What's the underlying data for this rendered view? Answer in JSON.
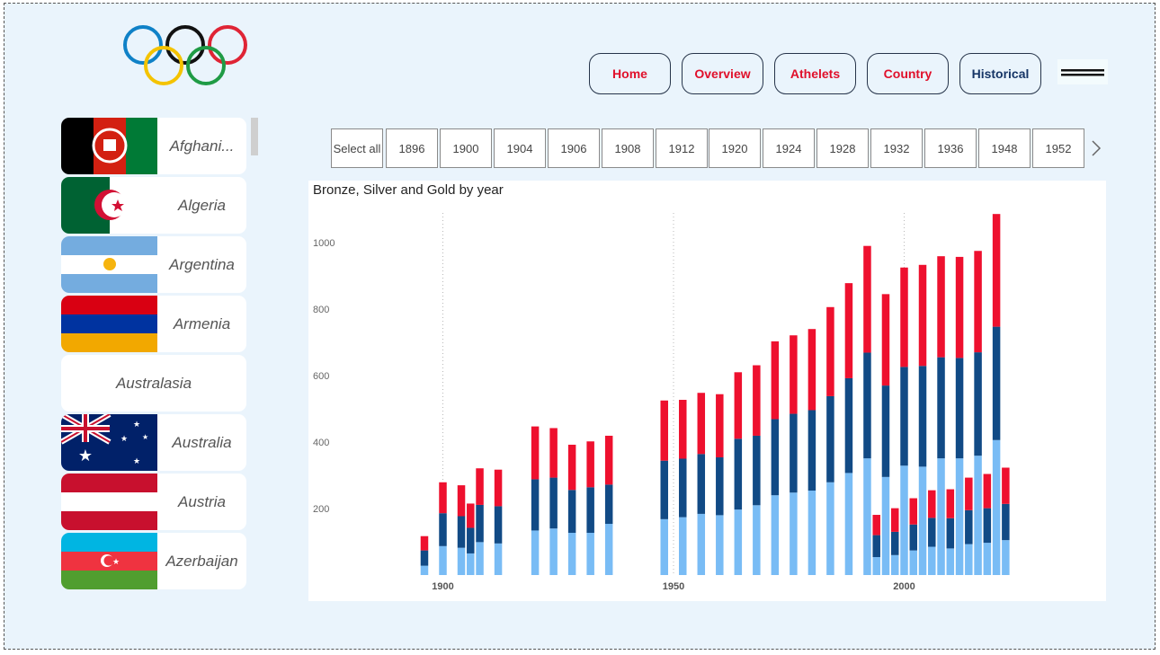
{
  "nav": {
    "home": "Home",
    "overview": "Overview",
    "athletes": "Athelets",
    "country": "Country",
    "historical": "Historical"
  },
  "countries": [
    {
      "name": "Afghani...",
      "flag": "afghanistan-flag"
    },
    {
      "name": "Algeria",
      "flag": "algeria-flag"
    },
    {
      "name": "Argentina",
      "flag": "argentina-flag"
    },
    {
      "name": "Armenia",
      "flag": "armenia-flag"
    },
    {
      "name": "Australasia",
      "flag": ""
    },
    {
      "name": "Australia",
      "flag": "australia-flag"
    },
    {
      "name": "Austria",
      "flag": "austria-flag"
    },
    {
      "name": "Azerbaijan",
      "flag": "azerbaijan-flag"
    }
  ],
  "year_slicer": {
    "select_all": "Select all",
    "years": [
      "1896",
      "1900",
      "1904",
      "1906",
      "1908",
      "1912",
      "1920",
      "1924",
      "1928",
      "1932",
      "1936",
      "1948",
      "1952"
    ]
  },
  "colors": {
    "bronze": "#79bcf5",
    "silver": "#114a85",
    "gold": "#ee102e",
    "nav_text": "#e0102b",
    "nav_active_text": "#163566",
    "background": "#eaf4fc"
  },
  "chart_data": {
    "type": "bar",
    "stacked": true,
    "title": "Bronze, Silver and Gold by year",
    "xlabel": "",
    "ylabel": "",
    "x_ticks": [
      1900,
      1950,
      2000
    ],
    "y_ticks": [
      200,
      400,
      600,
      800,
      1000
    ],
    "ylim": [
      0,
      1080
    ],
    "xlim": [
      1871,
      2028
    ],
    "grid": "vertical dotted at x ticks",
    "x": [
      1896,
      1900,
      1904,
      1906,
      1908,
      1912,
      1920,
      1924,
      1928,
      1932,
      1936,
      1948,
      1952,
      1956,
      1960,
      1964,
      1968,
      1972,
      1976,
      1980,
      1984,
      1988,
      1992,
      1994,
      1996,
      1998,
      2000,
      2002,
      2004,
      2006,
      2008,
      2010,
      2012,
      2014,
      2016,
      2018,
      2020,
      2022
    ],
    "series": [
      {
        "name": "Bronze",
        "color": "#79bcf5",
        "values": [
          28,
          87,
          82,
          65,
          99,
          95,
          134,
          140,
          127,
          127,
          154,
          168,
          174,
          184,
          180,
          197,
          210,
          240,
          248,
          254,
          279,
          307,
          351,
          54,
          295,
          60,
          329,
          74,
          326,
          85,
          351,
          80,
          351,
          93,
          359,
          97,
          406,
          105
        ]
      },
      {
        "name": "Silver",
        "color": "#114a85",
        "values": [
          46,
          99,
          95,
          77,
          112,
          112,
          154,
          153,
          129,
          137,
          118,
          176,
          176,
          180,
          174,
          213,
          209,
          229,
          237,
          242,
          259,
          285,
          318,
          66,
          275,
          70,
          297,
          78,
          303,
          87,
          304,
          91,
          302,
          102,
          311,
          104,
          341,
          109
        ]
      },
      {
        "name": "Gold",
        "color": "#ee102e",
        "values": [
          43,
          93,
          93,
          73,
          110,
          110,
          159,
          149,
          136,
          138,
          147,
          181,
          177,
          184,
          190,
          200,
          212,
          234,
          236,
          244,
          268,
          286,
          321,
          61,
          275,
          71,
          299,
          79,
          304,
          83,
          304,
          87,
          304,
          98,
          305,
          103,
          339,
          109
        ]
      }
    ]
  }
}
